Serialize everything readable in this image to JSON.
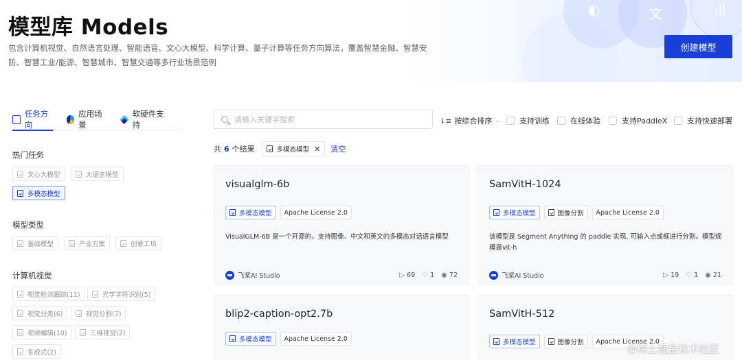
{
  "header": {
    "title": "模型库 Models",
    "description": "包含计算机视觉、自然语言处理、智能语音、文心大模型、科学计算、量子计算等任务方向算法，覆盖智慧金融、智慧安防、智慧工业/能源、智慧城市、智慧交通等多行业场景范例",
    "create_button": "创建模型",
    "deco_icons": [
      "speech-icon",
      "translate-icon",
      "audio-wave-icon"
    ]
  },
  "sidebar": {
    "tabs": [
      {
        "label": "任务方向",
        "icon": "task-icon",
        "active": true
      },
      {
        "label": "应用场景",
        "icon": "scene-icon",
        "active": false
      },
      {
        "label": "软硬件支持",
        "icon": "hardware-icon",
        "active": false
      }
    ],
    "sections": [
      {
        "title": "热门任务",
        "chips": [
          {
            "label": "文心大模型",
            "active": false
          },
          {
            "label": "大语言模型",
            "active": false
          },
          {
            "label": "多模态模型",
            "active": true
          }
        ]
      },
      {
        "title": "模型类型",
        "chips": [
          {
            "label": "基础模型",
            "active": false
          },
          {
            "label": "产业方案",
            "active": false
          },
          {
            "label": "创意工坊",
            "active": false
          }
        ]
      },
      {
        "title": "计算机视觉",
        "chips": [
          {
            "label": "视觉检测跟踪(11)",
            "active": false
          },
          {
            "label": "光学字符识别(5)",
            "active": false
          },
          {
            "label": "视觉分类(6)",
            "active": false
          },
          {
            "label": "视觉分割(7)",
            "active": false
          },
          {
            "label": "视频编辑(10)",
            "active": false
          },
          {
            "label": "三维视觉(2)",
            "active": false
          },
          {
            "label": "生成式(2)",
            "active": false
          }
        ]
      }
    ]
  },
  "toolbar": {
    "search_placeholder": "请输入关键字搜索",
    "sort_label": "按综合排序",
    "filters": [
      "支持训练",
      "在线体验",
      "支持PaddleX",
      "支持快速部署"
    ]
  },
  "results": {
    "prefix": "共",
    "count": "6",
    "suffix": "个结果",
    "active_filter": "多模态模型",
    "clear_label": "清空"
  },
  "cards": [
    {
      "title": "visualglm-6b",
      "tags": [
        {
          "label": "多模态模型",
          "blue": true,
          "icon": true
        },
        {
          "label": "Apache License 2.0",
          "blue": false,
          "icon": false
        }
      ],
      "description": "VisualGLM-6B 是一个开源的，支持图像、中文和英文的多模态对话语言模型",
      "source": "飞桨AI Studio",
      "runs": "69",
      "likes": "1",
      "views": "72"
    },
    {
      "title": "SamVitH-1024",
      "tags": [
        {
          "label": "多模态模型",
          "blue": true,
          "icon": true
        },
        {
          "label": "图像分割",
          "blue": false,
          "icon": true
        },
        {
          "label": "Apache License 2.0",
          "blue": false,
          "icon": false
        }
      ],
      "description": "该模型是 Segment Anything 的 paddle 实现, 可输入点或框进行分割。模型规模是vit-h",
      "source": "飞桨AI Studio",
      "runs": "19",
      "likes": "1",
      "views": "21"
    },
    {
      "title": "blip2-caption-opt2.7b",
      "tags": [
        {
          "label": "多模态模型",
          "blue": true,
          "icon": true
        },
        {
          "label": "Apache License 2.0",
          "blue": false,
          "icon": false
        }
      ]
    },
    {
      "title": "SamVitH-512",
      "tags": [
        {
          "label": "多模态模型",
          "blue": true,
          "icon": true
        },
        {
          "label": "图像分割",
          "blue": false,
          "icon": true
        },
        {
          "label": "Apache License 2.0",
          "blue": false,
          "icon": false
        }
      ]
    }
  ],
  "watermark": "@稀土掘金技术社区"
}
